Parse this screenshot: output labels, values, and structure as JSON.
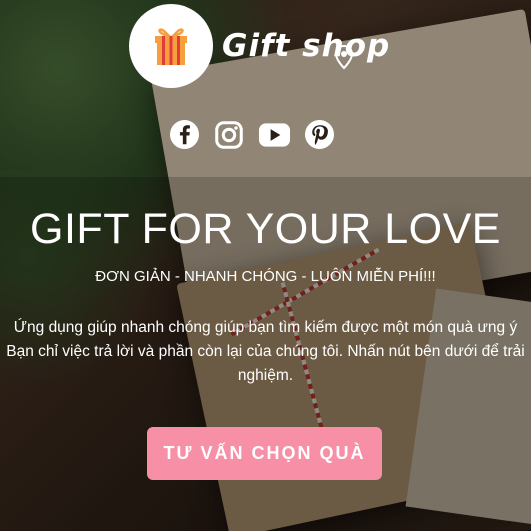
{
  "header": {
    "logo_text": "Gift shop",
    "logo_icon": "gift-box-icon"
  },
  "social": [
    {
      "name": "facebook-icon"
    },
    {
      "name": "instagram-icon"
    },
    {
      "name": "youtube-icon"
    },
    {
      "name": "pinterest-icon"
    }
  ],
  "hero": {
    "title": "GIFT FOR YOUR LOVE",
    "subtitle": "ĐƠN GIẢN - NHANH CHÓNG - LUÔN MIỄN PHÍ!!!",
    "description_line1": "Ứng dụng giúp nhanh chóng giúp bạn tìm kiếm được một món quà ưng ý",
    "description_line2": "Bạn chỉ việc trả lời và phần còn lại của chúng tôi. Nhấn nút bên dưới để trải nghiệm.",
    "cta_label": "TƯ VẤN CHỌN QUÀ"
  },
  "colors": {
    "cta_bg": "#f78fa7",
    "text": "#ffffff",
    "gift_orange": "#f5a03c"
  }
}
